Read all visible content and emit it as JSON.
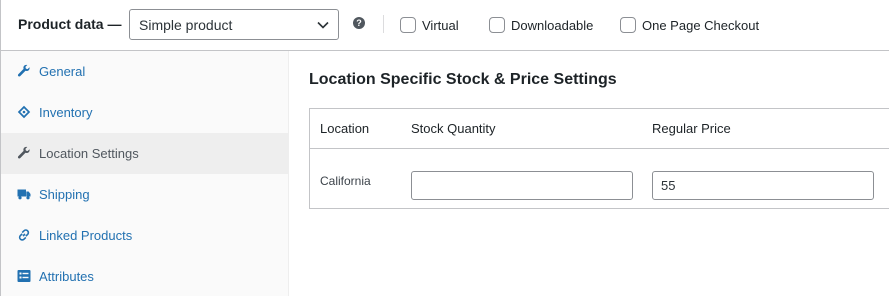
{
  "header": {
    "title": "Product data —",
    "product_type": {
      "selected": "Simple product"
    },
    "help_icon": "question-icon",
    "checkboxes": [
      {
        "label": "Virtual",
        "checked": false
      },
      {
        "label": "Downloadable",
        "checked": false
      },
      {
        "label": "One Page Checkout",
        "checked": false
      }
    ]
  },
  "sidebar": {
    "items": [
      {
        "label": "General",
        "icon": "wrench-icon",
        "active": false
      },
      {
        "label": "Inventory",
        "icon": "tag-icon",
        "active": false
      },
      {
        "label": "Location Settings",
        "icon": "wrench-icon",
        "active": true
      },
      {
        "label": "Shipping",
        "icon": "truck-icon",
        "active": false
      },
      {
        "label": "Linked Products",
        "icon": "link-icon",
        "active": false
      },
      {
        "label": "Attributes",
        "icon": "list-icon",
        "active": false
      }
    ]
  },
  "main": {
    "heading": "Location Specific Stock & Price Settings",
    "table": {
      "columns": [
        "Location",
        "Stock Quantity",
        "Regular Price"
      ],
      "rows": [
        {
          "location": "California",
          "stock_quantity": "",
          "regular_price": "55"
        }
      ]
    }
  },
  "colors": {
    "link": "#2271b1",
    "active_tab_bg": "#eeeeee",
    "border": "#c3c4c7"
  }
}
